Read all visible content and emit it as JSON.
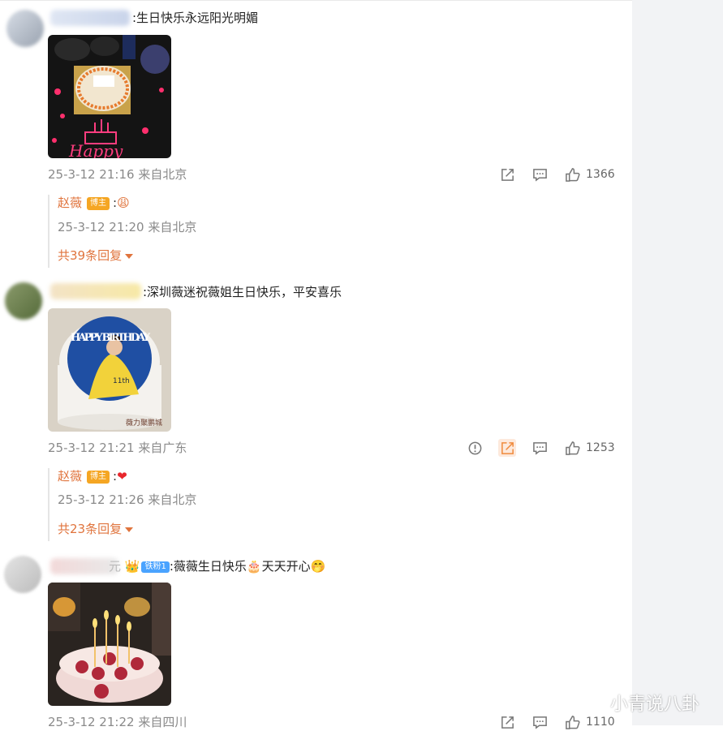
{
  "comments": [
    {
      "text": ":生日快乐永远阳光明媚",
      "time": "25-3-12 21:16",
      "location": "来自北京",
      "likes": "1366",
      "reply": {
        "name": "赵薇",
        "badge": "博主",
        "emoji": "😩",
        "time": "25-3-12 21:20",
        "location": "来自北京"
      },
      "more_replies": "共39条回复"
    },
    {
      "text": ":深圳薇迷祝薇姐生日快乐，平安喜乐",
      "time": "25-3-12 21:21",
      "location": "来自广东",
      "likes": "1253",
      "reply": {
        "name": "赵薇",
        "badge": "博主",
        "emoji": "❤",
        "time": "25-3-12 21:26",
        "location": "来自北京"
      },
      "more_replies": "共23条回复",
      "cake_text": {
        "big": "HAPPY BIRTHDAY",
        "sub": "11th",
        "footer": "薇力聚鹏城"
      }
    },
    {
      "name_suffix": "元",
      "fan_badge": "铁粉1",
      "text": ":薇薇生日快乐🎂天天开心🤭",
      "time": "25-3-12 21:22",
      "location": "来自四川",
      "likes": "1110"
    }
  ],
  "cake1_text": "Happy",
  "watermark": "小青说八卦",
  "icons": [
    "share-icon",
    "comment-icon",
    "like-icon",
    "report-icon"
  ],
  "colors": {
    "accent": "#e0743d",
    "badge": "#f5a623",
    "meta": "#8a8a8a"
  }
}
